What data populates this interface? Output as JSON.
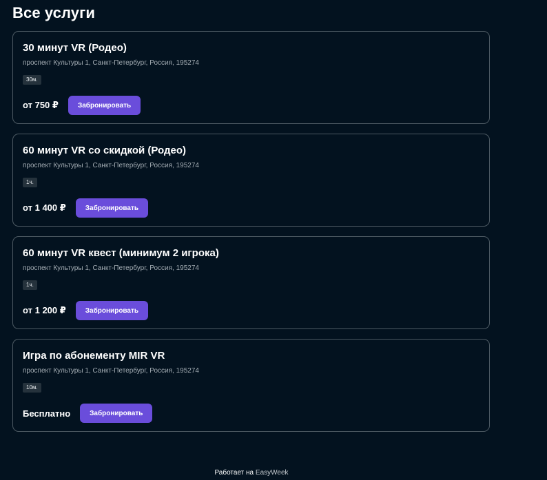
{
  "page": {
    "title": "Все услуги"
  },
  "services": [
    {
      "title": "30 минут VR (Родео)",
      "address": "проспект Культуры 1, Санкт-Петербург, Россия, 195274",
      "duration": "30м.",
      "price": "от 750 ₽",
      "book_label": "Забронировать"
    },
    {
      "title": "60 минут VR со скидкой (Родео)",
      "address": "проспект Культуры 1, Санкт-Петербург, Россия, 195274",
      "duration": "1ч.",
      "price": "от 1 400 ₽",
      "book_label": "Забронировать"
    },
    {
      "title": "60 минут VR квест (минимум 2 игрока)",
      "address": "проспект Культуры 1, Санкт-Петербург, Россия, 195274",
      "duration": "1ч.",
      "price": "от 1 200 ₽",
      "book_label": "Забронировать"
    },
    {
      "title": "Игра по абонементу MIR VR",
      "address": "проспект Культуры 1, Санкт-Петербург, Россия, 195274",
      "duration": "10м.",
      "price": "Бесплатно",
      "book_label": "Забронировать"
    }
  ],
  "footer": {
    "powered_by": "Работает на",
    "brand": "EasyWeek"
  },
  "colors": {
    "background": "#03121f",
    "card_border": "#4d5a63",
    "accent": "#6a4ddb",
    "badge_bg": "#25323c"
  }
}
